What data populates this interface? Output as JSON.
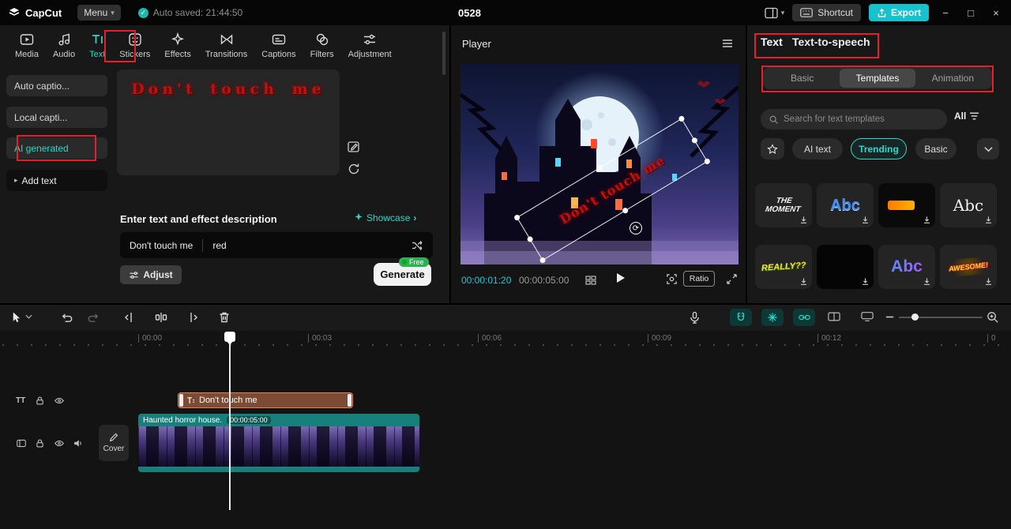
{
  "topbar": {
    "logo": "CapCut",
    "menu_label": "Menu",
    "autosave": "Auto saved: 21:44:50",
    "doc_title": "0528",
    "shortcut_label": "Shortcut",
    "export_label": "Export",
    "window": {
      "minimize": "−",
      "maximize": "□",
      "close": "×"
    }
  },
  "ribbon": {
    "tabs": [
      {
        "label": "Media"
      },
      {
        "label": "Audio"
      },
      {
        "label": "Text"
      },
      {
        "label": "Stickers"
      },
      {
        "label": "Effects"
      },
      {
        "label": "Transitions"
      },
      {
        "label": "Captions"
      },
      {
        "label": "Filters"
      },
      {
        "label": "Adjustment"
      }
    ]
  },
  "sidebar": {
    "items": [
      {
        "label": "Auto captio..."
      },
      {
        "label": "Local capti..."
      },
      {
        "label": "AI generated"
      },
      {
        "label": "Add text"
      }
    ]
  },
  "ai_text_panel": {
    "preview_text": "Don't touch me",
    "heading": "Enter text and effect description",
    "showcase_label": "Showcase",
    "prompt_text": "Don't touch me",
    "prompt_effect": "red",
    "adjust_label": "Adjust",
    "generate_label": "Generate",
    "free_badge": "Free"
  },
  "player": {
    "title": "Player",
    "overlay_text": "Don't touch me",
    "current_time": "00:00:01:20",
    "duration": "00:00:05:00",
    "ratio_label": "Ratio"
  },
  "text_library": {
    "tab_text": "Text",
    "tab_tts": "Text-to-speech",
    "subtabs": [
      {
        "label": "Basic"
      },
      {
        "label": "Templates"
      },
      {
        "label": "Animation"
      }
    ],
    "search_placeholder": "Search for text templates",
    "filter_label": "All",
    "chips": [
      {
        "label": "AI text"
      },
      {
        "label": "Trending"
      },
      {
        "label": "Basic"
      }
    ],
    "templates": [
      {
        "label": "THE MOMENT"
      },
      {
        "label": "Abc"
      },
      {
        "label": ""
      },
      {
        "label": "Abc"
      },
      {
        "label": "REALLY??"
      },
      {
        "label": ""
      },
      {
        "label": "Abc"
      },
      {
        "label": "AWESOME!"
      }
    ]
  },
  "timeline": {
    "ruler": [
      {
        "label": "00:00"
      },
      {
        "label": "00:03"
      },
      {
        "label": "00:06"
      },
      {
        "label": "00:09"
      },
      {
        "label": "00:12"
      },
      {
        "label": "0"
      }
    ],
    "text_track_badge": "TT",
    "text_clip_label": "Don't touch me",
    "video_clip_name": "Haunted horror house.",
    "video_clip_duration": "00:00:05:00",
    "cover_label": "Cover"
  },
  "colors": {
    "accent": "#2bd9c8",
    "export_bg": "#16c2cd",
    "annotation": "#e4202c"
  }
}
